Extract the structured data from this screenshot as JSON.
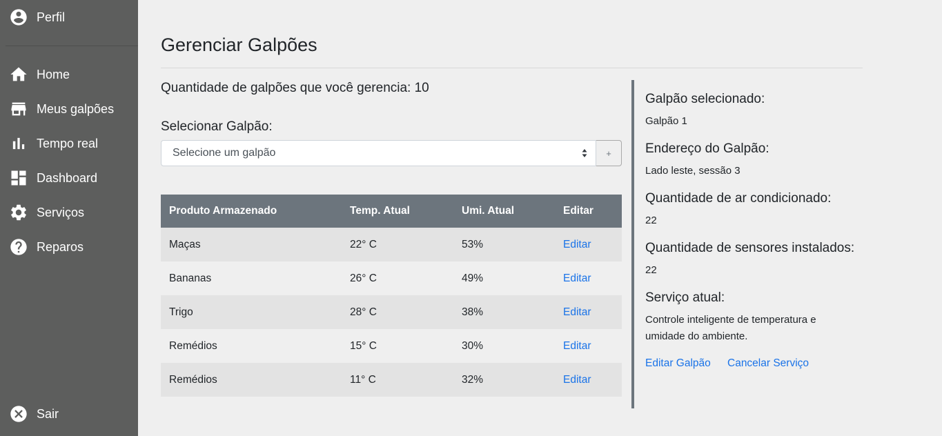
{
  "sidebar": {
    "profile": {
      "label": "Perfil",
      "icon": "account-circle-icon"
    },
    "items": [
      {
        "label": "Home",
        "icon": "home-icon"
      },
      {
        "label": "Meus galpões",
        "icon": "store-icon"
      },
      {
        "label": "Tempo real",
        "icon": "bar-chart-icon"
      },
      {
        "label": "Dashboard",
        "icon": "dashboard-icon"
      },
      {
        "label": "Serviços",
        "icon": "gear-icon"
      },
      {
        "label": "Reparos",
        "icon": "help-icon"
      }
    ],
    "logout": {
      "label": "Sair",
      "icon": "close-circle-icon"
    }
  },
  "main": {
    "title": "Gerenciar Galpões",
    "count_text": "Quantidade de galpões que você gerencia: 10",
    "select_label": "Selecionar Galpão:",
    "select_value": "Selecione um galpão",
    "add_button": "+",
    "table": {
      "headers": [
        "Produto Armazenado",
        "Temp. Atual",
        "Umi. Atual",
        "Editar"
      ],
      "rows": [
        {
          "produto": "Maças",
          "temp": "22° C",
          "umi": "53%",
          "acao": "Editar"
        },
        {
          "produto": "Bananas",
          "temp": "26° C",
          "umi": "49%",
          "acao": "Editar"
        },
        {
          "produto": "Trigo",
          "temp": "28° C",
          "umi": "38%",
          "acao": "Editar"
        },
        {
          "produto": "Remédios",
          "temp": "15° C",
          "umi": "30%",
          "acao": "Editar"
        },
        {
          "produto": "Remédios",
          "temp": "11° C",
          "umi": "32%",
          "acao": "Editar"
        }
      ]
    }
  },
  "details": {
    "selected_label": "Galpão selecionado:",
    "selected_value": "Galpão 1",
    "address_label": "Endereço do Galpão:",
    "address_value": "Lado leste, sessão 3",
    "ac_label": "Quantidade de ar condicionado:",
    "ac_value": "22",
    "sensors_label": "Quantidade de sensores instalados:",
    "sensors_value": "22",
    "service_label": "Serviço atual:",
    "service_value": "Controle inteligente de temperatura e umidade do ambiente.",
    "edit_link": "Editar Galpão",
    "cancel_link": "Cancelar Serviço"
  },
  "colors": {
    "sidebar_bg": "#5d5e5d",
    "page_bg": "#efefef",
    "table_header_bg": "#6c757d",
    "link": "#1a73e8"
  }
}
